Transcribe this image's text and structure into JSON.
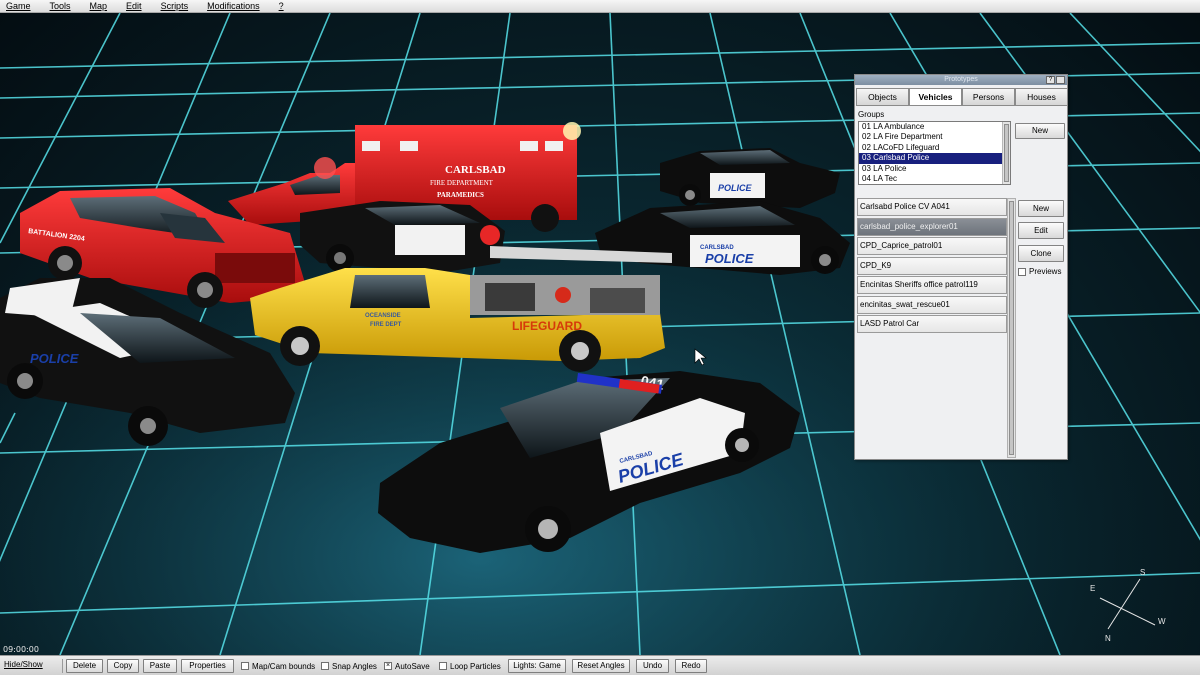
{
  "menubar": {
    "items": [
      {
        "label": "Game"
      },
      {
        "label": "Tools"
      },
      {
        "label": "Map"
      },
      {
        "label": "Edit"
      },
      {
        "label": "Scripts"
      },
      {
        "label": "Modifications"
      },
      {
        "label": "?"
      }
    ]
  },
  "viewport": {
    "clock": "09:00:00",
    "vehicle_decals": {
      "ambulance_line1": "CARLSBAD",
      "ambulance_line2": "FIRE DEPARTMENT",
      "ambulance_line3": "PARAMEDICS",
      "suv_red_text": "BATTALION 2204",
      "lifeguard_text": "LIFEGUARD",
      "lifeguard_door": "OCEANSIDE",
      "lifeguard_door2": "FIRE DEPT",
      "police_text": "POLICE",
      "carlsbad_text": "CARLSBAD",
      "roof_number": "041"
    },
    "compass": {
      "n": "N",
      "s": "S",
      "e": "E",
      "w": "W"
    }
  },
  "prototypes_panel": {
    "title": "Prototypes",
    "help_glyph": "?",
    "tabs": [
      {
        "label": "Objects",
        "active": false
      },
      {
        "label": "Vehicles",
        "active": true
      },
      {
        "label": "Persons",
        "active": false
      },
      {
        "label": "Houses",
        "active": false
      }
    ],
    "groups_label": "Groups",
    "groups": [
      {
        "label": "01 LA Ambulance",
        "selected": false
      },
      {
        "label": "02 LA Fire Department",
        "selected": false
      },
      {
        "label": "02 LACoFD Lifeguard",
        "selected": false
      },
      {
        "label": "03 Carlsbad Police",
        "selected": true
      },
      {
        "label": "03 LA Police",
        "selected": false
      },
      {
        "label": "04 LA Tec",
        "selected": false
      }
    ],
    "group_new_label": "New",
    "vehicles": [
      {
        "label": "Carlsabd Police CV A041",
        "selected": false
      },
      {
        "label": "carlsbad_police_explorer01",
        "selected": true
      },
      {
        "label": "CPD_Caprice_patrol01",
        "selected": false
      },
      {
        "label": "CPD_K9",
        "selected": false
      },
      {
        "label": "Encinitas Sheriffs office patrol119",
        "selected": false
      },
      {
        "label": "encinitas_swat_rescue01",
        "selected": false
      },
      {
        "label": "LASD Patrol Car",
        "selected": false
      }
    ],
    "vehicle_buttons": {
      "new": "New",
      "edit": "Edit",
      "clone": "Clone"
    },
    "previews_label": "Previews",
    "previews_checked": false
  },
  "toolbar": {
    "hide_show": "Hide/Show",
    "delete": "Delete",
    "copy": "Copy",
    "paste": "Paste",
    "properties": "Properties",
    "map_cam_bounds": "Map/Cam bounds",
    "map_cam_bounds_checked": false,
    "snap_angles": "Snap Angles",
    "snap_angles_checked": false,
    "autosave": "AutoSave",
    "autosave_checked": true,
    "loop_particles": "Loop Particles",
    "loop_particles_checked": false,
    "lights": "Lights: Game",
    "reset_angles": "Reset Angles",
    "undo": "Undo",
    "redo": "Redo"
  },
  "colors": {
    "grid_line": "#57e2ea",
    "grid_glow": "#2aa8c0",
    "fire_red": "#d51a1a",
    "lifeguard_yellow": "#f2c612",
    "police_white": "#f4f4f4",
    "police_black": "#0c0c0c",
    "police_blue": "#1a3fa8",
    "selection_navy": "#18207e"
  }
}
